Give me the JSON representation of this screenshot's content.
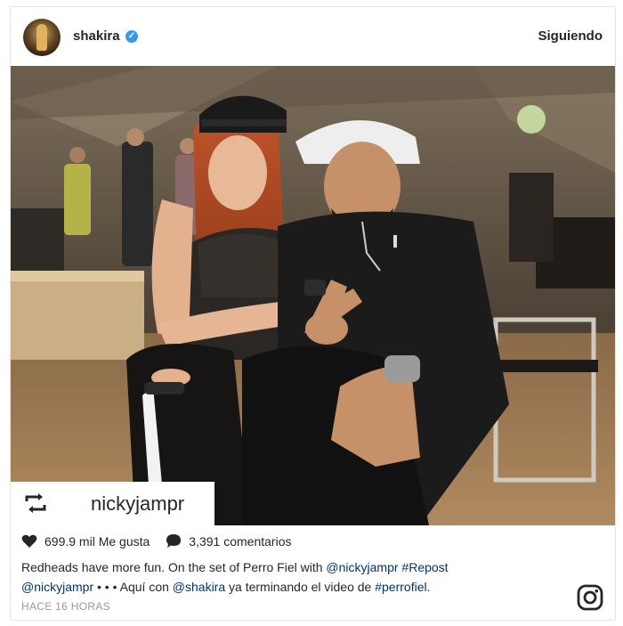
{
  "post": {
    "username": "shakira",
    "verified_symbol": "✓",
    "follow_label": "Siguiendo",
    "repost_user": "nickyjampr",
    "likes_text": "699.9 mil Me gusta",
    "comments_text": "3,391 comentarios",
    "caption": {
      "part1": "Redheads have more fun. On the set of Perro Fiel with ",
      "mention1": "@nickyjampr",
      "space1": " ",
      "hashtag1": "#Repost",
      "space2": " ",
      "mention2": "@nickyjampr",
      "dots": " • • • ",
      "part2": " Aquí con ",
      "mention3": "@shakira",
      "part3": " ya terminando el video de ",
      "hashtag2": "#perrofiel",
      "end": "."
    },
    "timestamp": "HACE 16 HORAS"
  },
  "icons": {
    "verified": "verified-badge-icon",
    "repost": "repost-icon",
    "like": "heart-icon",
    "comment": "comment-bubble-icon",
    "brand": "instagram-logo-icon"
  },
  "colors": {
    "text": "#262626",
    "link": "#003569",
    "verified": "#3897f0",
    "muted": "#999999"
  }
}
